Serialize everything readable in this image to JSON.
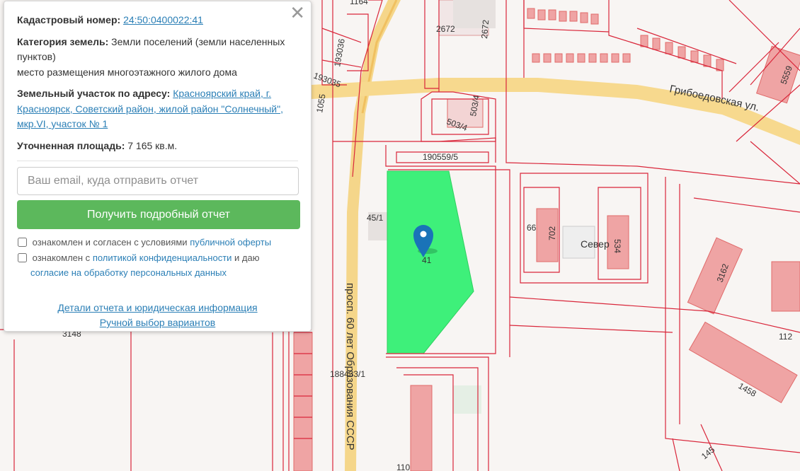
{
  "panel": {
    "close_symbol": "✕",
    "cadastral_label": "Кадастровый номер:",
    "cadastral_number": "24:50:0400022:41",
    "category_label": "Категория земель:",
    "category_value": "Земли поселений (земли населенных пунктов)",
    "category_purpose": "место размещения многоэтажного жилого дома",
    "address_label": "Земельный участок по адресу:",
    "address_value": "Красноярский край, г. Красноярск, Советский район, жилой район \"Солнечный\", мкр.VI, участок № 1",
    "area_label": "Уточненная площадь:",
    "area_value": "7 165 кв.м.",
    "email_placeholder": "Ваш email, куда отправить отчет",
    "submit_label": "Получить подробный отчет",
    "consent1_text": "ознакомлен и согласен с условиями",
    "consent1_link": "публичной оферты",
    "consent2_text_a": "ознакомлен с",
    "consent2_link": "политикой конфиденциальности",
    "consent2_text_b": "и даю",
    "consent2_link2": "согласие на обработку персональных данных",
    "details_link": "Детали отчета и юридическая информация",
    "manual_link": "Ручной выбор вариантов"
  },
  "map": {
    "highlight_color": "#3ef07a",
    "boundary_color": "#d9263a",
    "building_color": "#f0a0a0",
    "road_color": "#f5cf7a",
    "marker_color": "#1a73b8",
    "labels": {
      "street_main": "просп. 60 лет Образования СССР",
      "street_gribo": "Грибоедовская ул.",
      "district": "Север",
      "n3148": "3148",
      "n188433": "188433/1",
      "n190559": "190559/5",
      "n503_4a": "503/4",
      "n503_4b": "503/4",
      "n2672a": "2672",
      "n2672b": "2672",
      "n193036": "193036",
      "n193035": "193035",
      "n45_1": "45/1",
      "n41": "41",
      "n66": "66",
      "n702": "702",
      "n534": "534",
      "n3162": "3162",
      "n112": "112",
      "n1458": "1458",
      "n145": "145",
      "n110": "110",
      "n5559": "5559",
      "n1055": "1055",
      "n1164": "1164"
    }
  }
}
